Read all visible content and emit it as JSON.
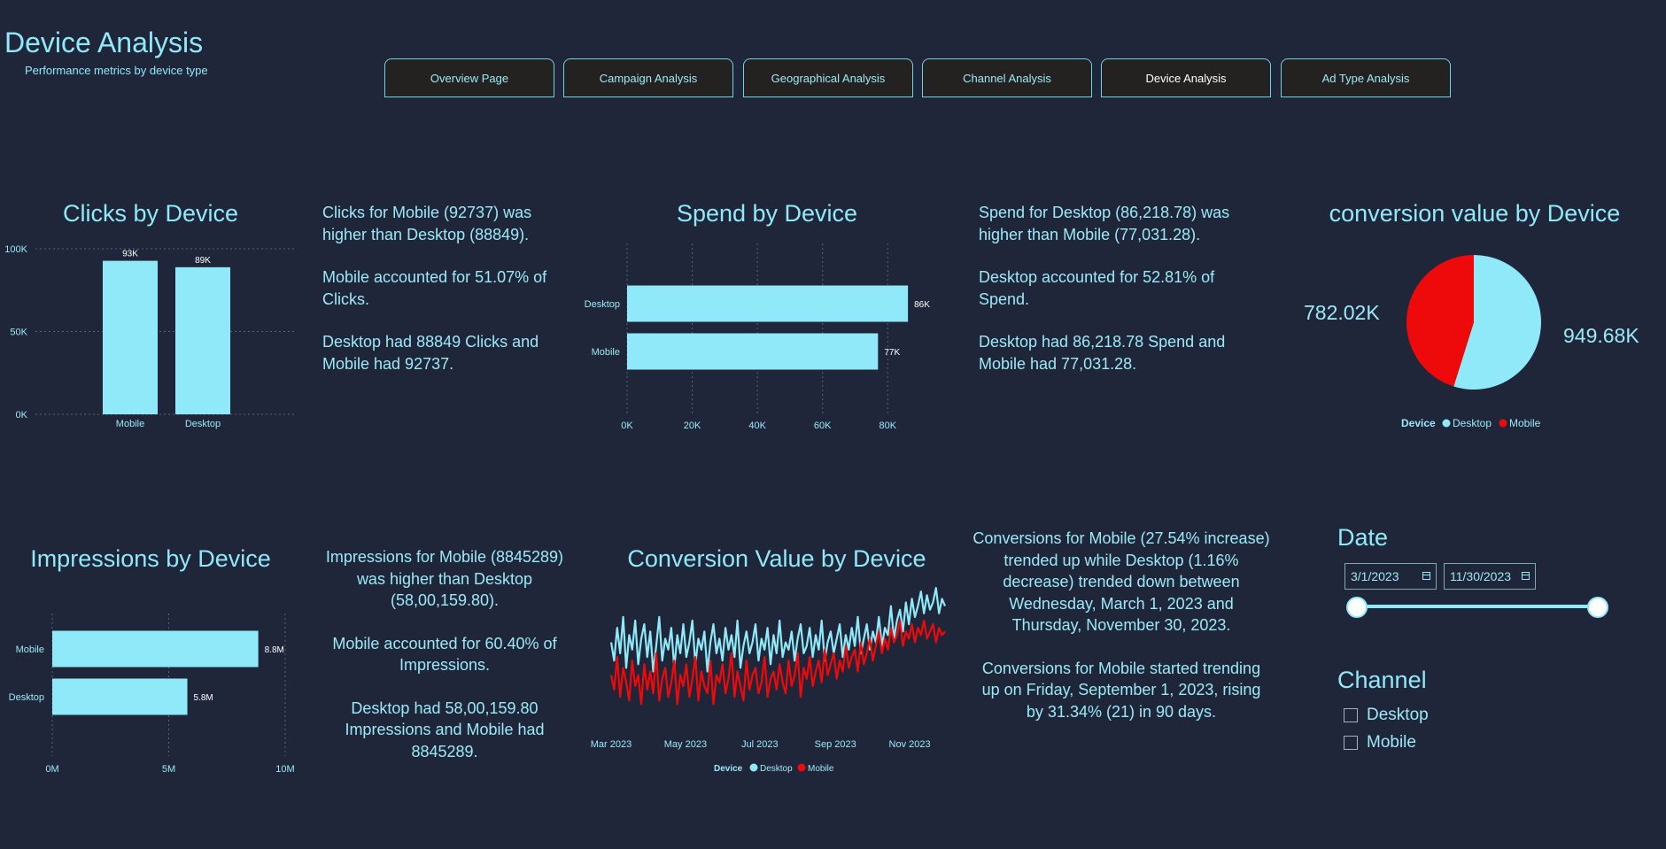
{
  "header": {
    "title": "Device Analysis",
    "subtitle": "Performance metrics by device type"
  },
  "nav": {
    "items": [
      {
        "label": "Overview Page"
      },
      {
        "label": "Campaign Analysis"
      },
      {
        "label": "Geographical Analysis"
      },
      {
        "label": "Channel Analysis"
      },
      {
        "label": "Device Analysis"
      },
      {
        "label": "Ad Type Analysis"
      }
    ],
    "active": "Device Analysis"
  },
  "narratives": {
    "clicks": [
      "Clicks for Mobile (92737) was higher than Desktop (88849).",
      "Mobile accounted for 51.07% of Clicks.",
      "Desktop had 88849 Clicks and Mobile had 92737."
    ],
    "spend": [
      "Spend for Desktop (86,218.78) was higher than Mobile (77,031.28).",
      "Desktop accounted for 52.81% of Spend.",
      "Desktop had 86,218.78 Spend and Mobile had 77,031.28."
    ],
    "impressions": [
      "Impressions for Mobile (8845289) was higher than Desktop (58,00,159.80).",
      "Mobile accounted for 60.40% of Impressions.",
      "Desktop had 58,00,159.80 Impressions and Mobile had 8845289."
    ],
    "conversions": [
      "Conversions for Mobile (27.54% increase) trended up while Desktop (1.16% decrease) trended down between Wednesday, March 1, 2023 and Thursday, November 30, 2023.",
      "Conversions for Mobile started trending up on Friday, September 1, 2023, rising by 31.34% (21) in 90 days."
    ]
  },
  "filters": {
    "date": {
      "title": "Date",
      "start": "3/1/2023",
      "end": "11/30/2023",
      "range_fraction": [
        0,
        1
      ]
    },
    "channel": {
      "title": "Channel",
      "options": [
        {
          "label": "Desktop",
          "checked": false
        },
        {
          "label": "Mobile",
          "checked": false
        }
      ]
    }
  },
  "colors": {
    "desktop": "#8fe9f8",
    "mobile": "#ee0a0a",
    "background": "#1f2639"
  },
  "chart_data": [
    {
      "id": "clicks",
      "type": "bar",
      "orientation": "vertical",
      "title": "Clicks by Device",
      "categories": [
        "Mobile",
        "Desktop"
      ],
      "values": [
        92737,
        88849
      ],
      "data_labels": [
        "93K",
        "89K"
      ],
      "ylim": [
        0,
        100000
      ],
      "yticks": [
        0,
        50000,
        100000
      ],
      "ytick_labels": [
        "0K",
        "50K",
        "100K"
      ],
      "grid": true
    },
    {
      "id": "spend",
      "type": "bar",
      "orientation": "horizontal",
      "title": "Spend by Device",
      "categories": [
        "Desktop",
        "Mobile"
      ],
      "values": [
        86218.78,
        77031.28
      ],
      "data_labels": [
        "86K",
        "77K"
      ],
      "xlim": [
        0,
        87000
      ],
      "xticks": [
        0,
        20000,
        40000,
        60000,
        80000
      ],
      "xtick_labels": [
        "0K",
        "20K",
        "40K",
        "60K",
        "80K"
      ],
      "grid": true
    },
    {
      "id": "conversion-value-pie",
      "type": "pie",
      "title": "conversion value by Device",
      "legend_title": "Device",
      "categories": [
        "Desktop",
        "Mobile"
      ],
      "values": [
        949680,
        782020
      ],
      "data_labels": [
        "949.68K",
        "782.02K"
      ],
      "legend": "bottom"
    },
    {
      "id": "impressions",
      "type": "bar",
      "orientation": "horizontal",
      "title": "Impressions by Device",
      "categories": [
        "Mobile",
        "Desktop"
      ],
      "values": [
        8845289,
        5800159.8
      ],
      "data_labels": [
        "8.8M",
        "5.8M"
      ],
      "xlim": [
        0,
        10000000
      ],
      "xticks": [
        0,
        5000000,
        10000000
      ],
      "xtick_labels": [
        "0M",
        "5M",
        "10M"
      ],
      "grid": true
    },
    {
      "id": "conversion-value-line",
      "type": "line",
      "title": "Conversion Value by Device",
      "legend_title": "Device",
      "x_start": "2023-03-01",
      "x_end": "2023-11-30",
      "xtick_labels": [
        "Mar 2023",
        "May 2023",
        "Jul 2023",
        "Sep 2023",
        "Nov 2023"
      ],
      "xtick_dates": [
        "2023-03-01",
        "2023-05-01",
        "2023-07-01",
        "2023-09-01",
        "2023-11-01"
      ],
      "legend": "bottom",
      "grid": false,
      "series": [
        {
          "name": "Desktop",
          "color": "#8fe9f8",
          "values": [
            3800,
            3300,
            4200,
            3500,
            4500,
            3100,
            4000,
            3600,
            4400,
            3200,
            3900,
            4300,
            3400,
            4100,
            3000,
            3700,
            4500,
            3300,
            3900,
            3600,
            4200,
            3100,
            4000,
            3500,
            4300,
            3400,
            3800,
            4400,
            3200,
            3900,
            3600,
            4100,
            3000,
            3800,
            4300,
            3500,
            3900,
            3300,
            4200,
            3600,
            4000,
            3400,
            4400,
            3100,
            3700,
            4100,
            3500,
            3800,
            4300,
            3300,
            3900,
            3600,
            4200,
            3200,
            4000,
            3500,
            4400,
            3400,
            3800,
            3600,
            4100,
            3300,
            3900,
            4300,
            3500,
            3700,
            4200,
            3400,
            4000,
            3600,
            4400,
            3300,
            3800,
            4100,
            3500,
            3900,
            4300,
            3400,
            4000,
            3600,
            4200,
            3700,
            4500,
            3500,
            3900,
            4300,
            3600,
            4100,
            3800,
            4500,
            3700,
            4200,
            4000,
            4800,
            3900,
            4400,
            4700,
            4100,
            4900,
            4300,
            5000,
            4500,
            4800,
            5200,
            4600,
            5100,
            4700,
            4900,
            5300,
            4600,
            5000,
            4800
          ]
        },
        {
          "name": "Mobile",
          "color": "#ee0a0a",
          "values": [
            2900,
            2500,
            3400,
            2300,
            3100,
            2700,
            2200,
            3300,
            2600,
            2900,
            2100,
            3200,
            2500,
            3000,
            2400,
            3500,
            2200,
            2800,
            3100,
            2300,
            2700,
            3300,
            2100,
            2900,
            2600,
            3200,
            2300,
            2800,
            3400,
            2200,
            3000,
            2600,
            2400,
            3300,
            2100,
            2900,
            2700,
            3200,
            2400,
            2800,
            3500,
            2300,
            3000,
            2600,
            2200,
            3300,
            2500,
            2900,
            3100,
            2400,
            2700,
            3400,
            2300,
            2800,
            3000,
            2500,
            3200,
            2700,
            2400,
            3300,
            2600,
            2900,
            3500,
            2300,
            3100,
            2800,
            3400,
            2600,
            3000,
            3300,
            2700,
            3600,
            2900,
            3200,
            3500,
            2800,
            3300,
            3000,
            3700,
            3100,
            3400,
            3600,
            3000,
            3800,
            3200,
            3500,
            3900,
            3300,
            3700,
            4100,
            3500,
            3900,
            3600,
            4200,
            3800,
            4000,
            4400,
            3700,
            4100,
            3900,
            4300,
            3800,
            4200,
            4000,
            4400,
            3900,
            4100,
            4300,
            3800,
            4200,
            4000,
            4100
          ]
        }
      ]
    }
  ]
}
